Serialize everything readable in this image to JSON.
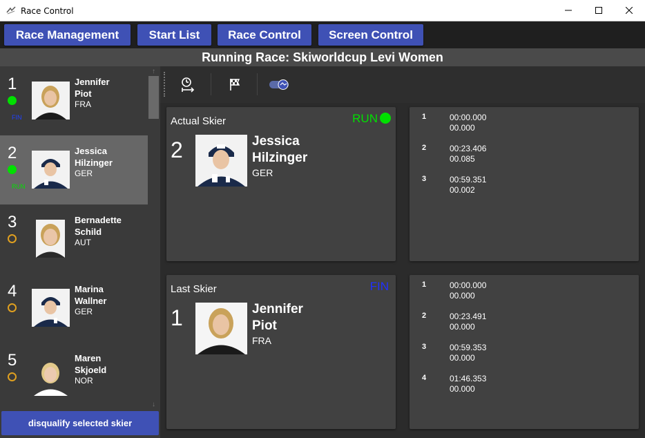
{
  "window": {
    "title": "Race Control"
  },
  "nav": {
    "race_management": "Race Management",
    "start_list": "Start List",
    "race_control": "Race Control",
    "screen_control": "Screen Control"
  },
  "race": {
    "header": "Running Race: Skiworldcup Levi Women"
  },
  "skiers": [
    {
      "num": "1",
      "first": "Jennifer",
      "last": "Piot",
      "nation": "FRA",
      "status": "FIN",
      "dot": "green"
    },
    {
      "num": "2",
      "first": "Jessica",
      "last": "Hilzinger",
      "nation": "GER",
      "status": "RUN",
      "dot": "green"
    },
    {
      "num": "3",
      "first": "Bernadette",
      "last": "Schild",
      "nation": "AUT",
      "status": "",
      "dot": "orange"
    },
    {
      "num": "4",
      "first": "Marina",
      "last": "Wallner",
      "nation": "GER",
      "status": "",
      "dot": "orange"
    },
    {
      "num": "5",
      "first": "Maren",
      "last": "Skjoeld",
      "nation": "NOR",
      "status": "",
      "dot": "orange"
    }
  ],
  "disqualify_label": "disqualify selected skier",
  "actual": {
    "label": "Actual Skier",
    "state": "RUN",
    "num": "2",
    "first": "Jessica",
    "last": "Hilzinger",
    "nation": "GER",
    "splits": [
      {
        "idx": "1",
        "time": "00:00.000",
        "diff": "00.000"
      },
      {
        "idx": "2",
        "time": "00:23.406",
        "diff": "00.085"
      },
      {
        "idx": "3",
        "time": "00:59.351",
        "diff": "00.002"
      }
    ]
  },
  "last": {
    "label": "Last Skier",
    "state": "FIN",
    "num": "1",
    "first": "Jennifer",
    "last": "Piot",
    "nation": "FRA",
    "splits": [
      {
        "idx": "1",
        "time": "00:00.000",
        "diff": "00.000"
      },
      {
        "idx": "2",
        "time": "00:23.491",
        "diff": "00.000"
      },
      {
        "idx": "3",
        "time": "00:59.353",
        "diff": "00.000"
      },
      {
        "idx": "4",
        "time": "01:46.353",
        "diff": "00.000"
      }
    ]
  },
  "colors": {
    "accent": "#3f51b5",
    "run": "#00e000",
    "fin": "#2030ff",
    "pending": "#e0a020"
  },
  "icons": [
    "timer-icon",
    "checkered-flag-icon",
    "toggle-icon"
  ]
}
